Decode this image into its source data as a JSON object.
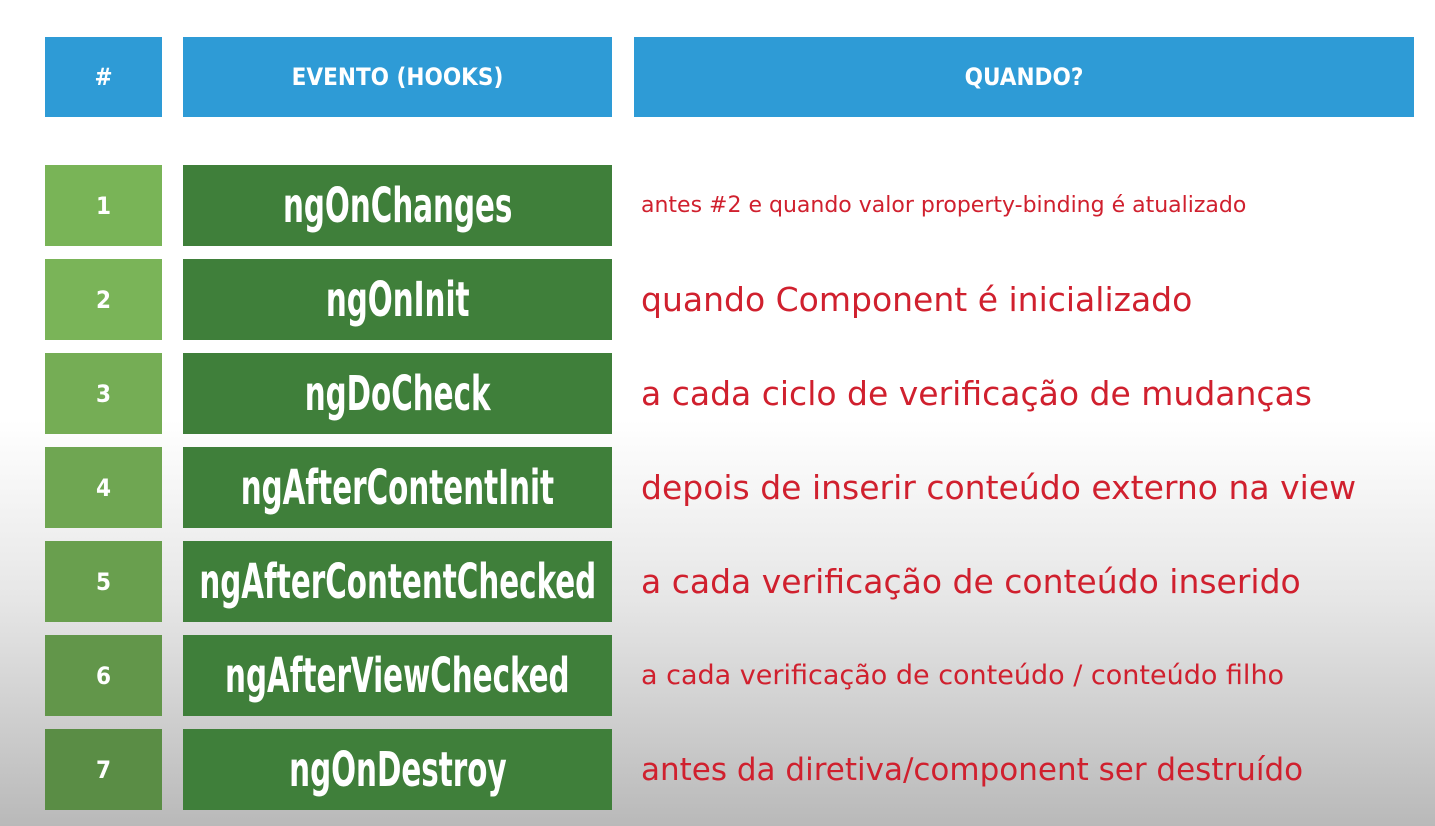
{
  "header": {
    "num_label": "#",
    "event_label": "EVENTO (HOOKS)",
    "when_label": "QUANDO?"
  },
  "colors": {
    "header_blue": "#2e9bd6",
    "hook_green": "#3f7f3a",
    "description_red": "#d0202e",
    "number_greens": [
      "#79b457",
      "#7ab458",
      "#75ad55",
      "#6fa652",
      "#699f4e",
      "#62964a",
      "#5a8d45"
    ]
  },
  "rows": [
    {
      "num": "1",
      "hook": "ngOnChanges",
      "desc": "antes #2 e quando valor property-binding é atualizado"
    },
    {
      "num": "2",
      "hook": "ngOnInit",
      "desc": "quando Component é inicializado"
    },
    {
      "num": "3",
      "hook": "ngDoCheck",
      "desc": "a cada ciclo de verificação de mudanças"
    },
    {
      "num": "4",
      "hook": "ngAfterContentInit",
      "desc": "depois de inserir conteúdo externo na view"
    },
    {
      "num": "5",
      "hook": "ngAfterContentChecked",
      "desc": "a cada verificação de conteúdo inserido"
    },
    {
      "num": "6",
      "hook": "ngAfterViewChecked",
      "desc": "a cada verificação de conteúdo / conteúdo filho"
    },
    {
      "num": "7",
      "hook": "ngOnDestroy",
      "desc": "antes da diretiva/component ser destruído"
    }
  ]
}
